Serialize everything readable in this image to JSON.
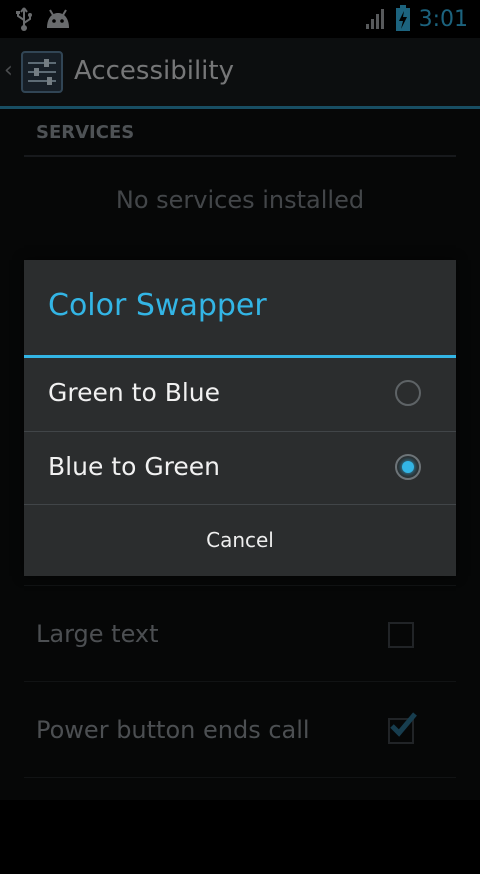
{
  "status_bar": {
    "time": "3:01",
    "icons": [
      "usb-icon",
      "android-icon",
      "signal-icon",
      "battery-charging-icon"
    ],
    "accent_color": "#33b5e5"
  },
  "action_bar": {
    "title": "Accessibility",
    "back_icon": "chevron-left-icon",
    "app_icon": "settings-sliders-icon"
  },
  "content": {
    "section_header": "SERVICES",
    "empty_text": "No services installed",
    "prefs": [
      {
        "label": "Large text",
        "checked": false
      },
      {
        "label": "Power button ends call",
        "checked": true
      }
    ]
  },
  "dialog": {
    "title": "Color Swapper",
    "options": [
      {
        "label": "Green to Blue",
        "selected": false
      },
      {
        "label": "Blue to Green",
        "selected": true
      }
    ],
    "cancel_label": "Cancel"
  }
}
